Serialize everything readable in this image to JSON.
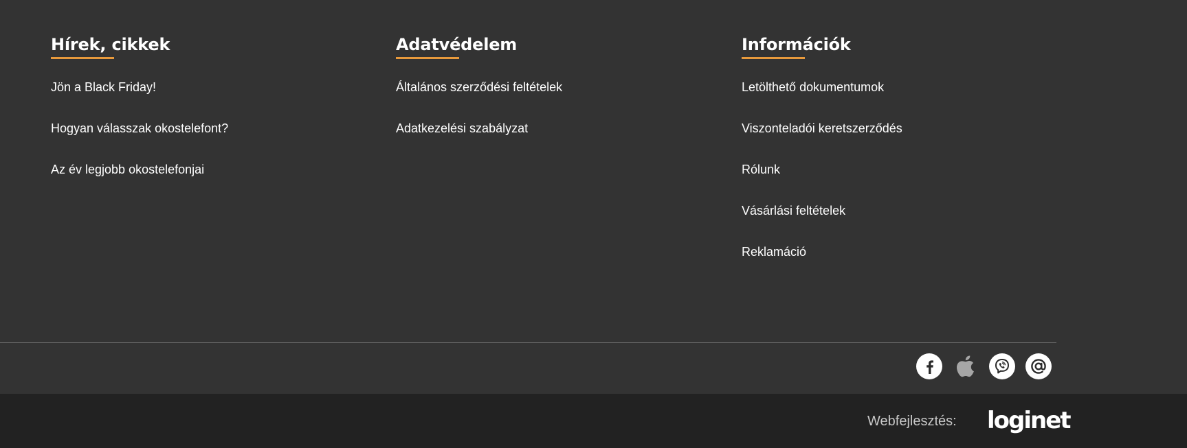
{
  "columns": [
    {
      "title": "Hírek, cikkek",
      "links": [
        "Jön a Black Friday!",
        "Hogyan válasszak okostelefont?",
        "Az év legjobb okostelefonjai"
      ]
    },
    {
      "title": "Adatvédelem",
      "links": [
        "Általános szerződési feltételek",
        "Adatkezelési szabályzat"
      ]
    },
    {
      "title": "Információk",
      "links": [
        "Letölthető dokumentumok",
        "Viszonteladói keretszerződés",
        "Rólunk",
        "Vásárlási feltételek",
        "Reklamáció"
      ]
    }
  ],
  "social": [
    "facebook-icon",
    "apple-icon",
    "viber-icon",
    "email-at-icon"
  ],
  "credit": {
    "label": "Webfejlesztés:",
    "logo_text": "loginet"
  },
  "colors": {
    "background": "#333333",
    "bottom_bar": "#222222",
    "accent": "#e89a3c",
    "text": "#ffffff"
  }
}
